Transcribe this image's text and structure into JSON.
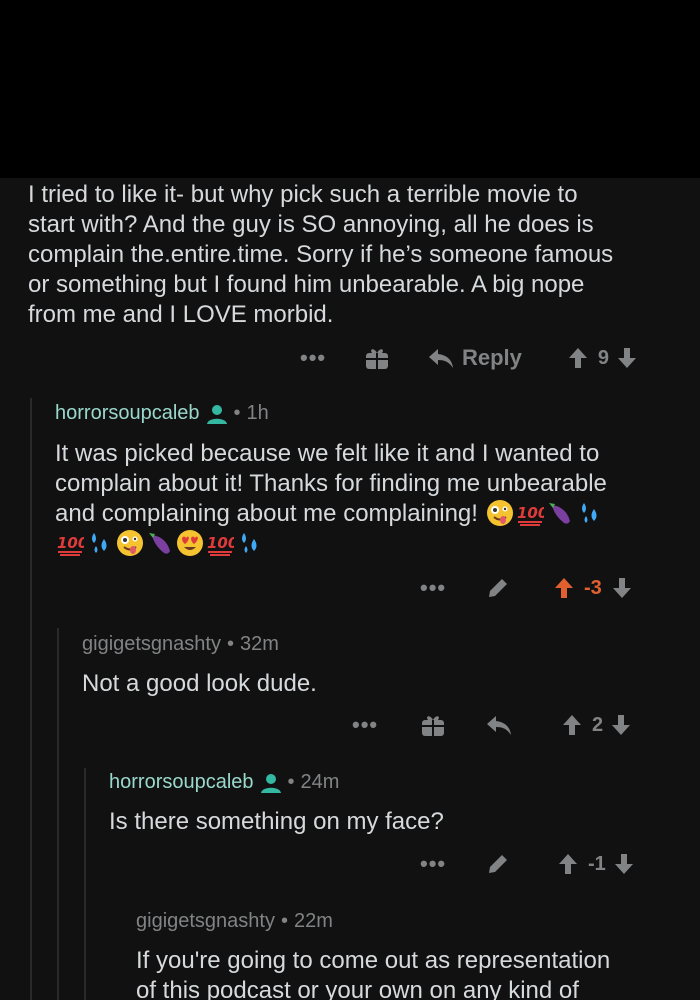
{
  "parent": {
    "text_lines": [
      "I tried to like it- but why pick such a terrible movie to",
      "start with? And the guy is SO annoying, all he does is",
      "complain the.entire.time. Sorry if he’s someone famous",
      "or something but I found him unbearable. A big nope",
      "from me and I LOVE morbid."
    ],
    "actions": {
      "more": "•••",
      "reply": "Reply",
      "score": "9"
    }
  },
  "c1": {
    "author": "horrorsoupcaleb",
    "time": "1h",
    "text_lines": [
      "It was picked because we felt like it and I wanted to",
      "complain about it! Thanks for finding me unbearable",
      "and complaining about me complaining!"
    ],
    "emojis_line3": [
      "zany-face",
      "hundred",
      "eggplant",
      "sweat-drops"
    ],
    "emojis_line4": [
      "hundred",
      "sweat-drops",
      "zany-face",
      "eggplant",
      "heart-eyes",
      "hundred",
      "sweat-drops"
    ],
    "actions": {
      "more": "•••",
      "score": "-3"
    }
  },
  "c2": {
    "author": "gigigetsgnashty",
    "time": "32m",
    "text": "Not a good look dude.",
    "actions": {
      "more": "•••",
      "score": "2"
    }
  },
  "c3": {
    "author": "horrorsoupcaleb",
    "time": "24m",
    "text": "Is there something on my face?",
    "actions": {
      "more": "•••",
      "score": "-1"
    }
  },
  "c4": {
    "author": "gigigetsgnashty",
    "time": "22m",
    "text_lines": [
      "If you're going to come out as representation",
      "of this podcast or your own on any kind of"
    ]
  },
  "sep": "•"
}
